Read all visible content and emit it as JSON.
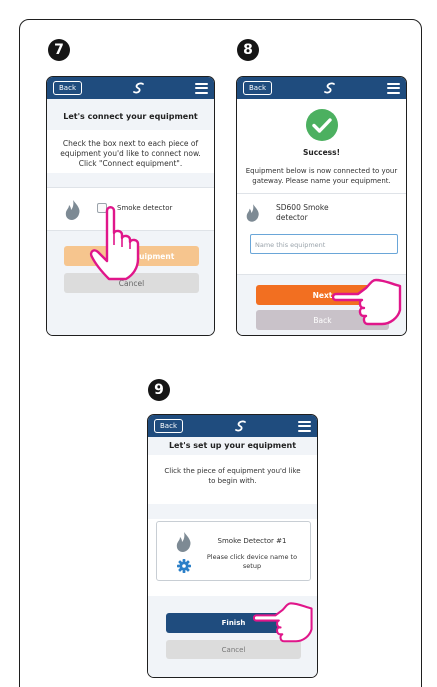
{
  "steps": {
    "step7": {
      "number": "7",
      "back": "Back",
      "title": "Let's connect your equipment",
      "instructions": "Check the box next to each piece of equipment you'd like to connect now. Click \"Connect equipment\".",
      "device": "Smoke detector",
      "connect_button": "equipment",
      "cancel_button": "Cancel"
    },
    "step8": {
      "number": "8",
      "back": "Back",
      "success_title": "Success!",
      "message": "Equipment below is now connected to your gateway. Please name your equipment.",
      "device_line1": "SD600 Smoke",
      "device_line2": "detector",
      "name_placeholder": "Name this equipment",
      "next_button": "Next",
      "back_button": "Back"
    },
    "step9": {
      "number": "9",
      "back": "Back",
      "title": "Let's set up your equipment",
      "instructions": "Click the piece of equipment you'd like to begin with.",
      "device_name": "Smoke Detector #1",
      "hint": "Please click device name to setup",
      "finish_button": "Finish",
      "cancel_button": "Cancel"
    }
  },
  "colors": {
    "topbar": "#1f4c7e",
    "orange": "#f26f21",
    "orange_disabled": "#f6c58e",
    "success_green": "#4cb060",
    "hand_pink": "#e0168a",
    "finish_blue": "#1f4c7e"
  }
}
